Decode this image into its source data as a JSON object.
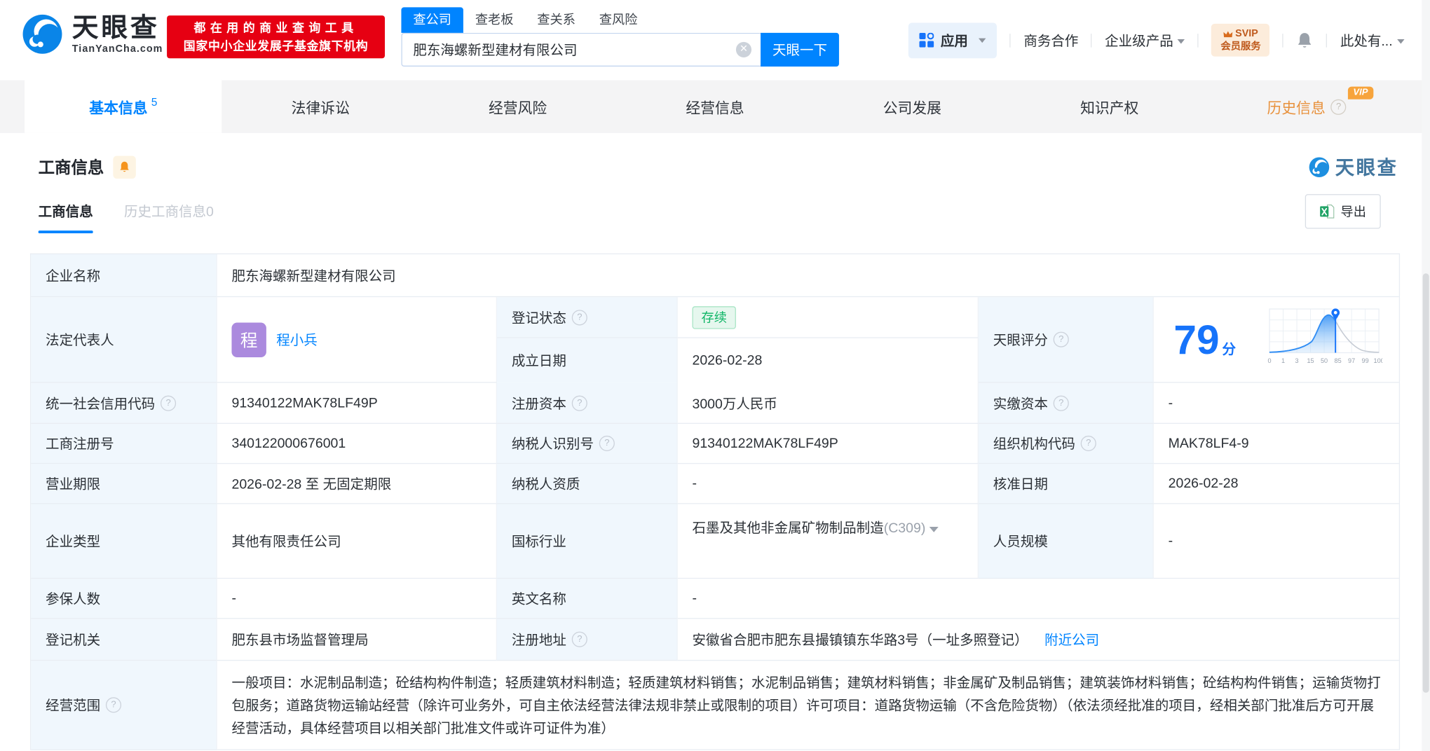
{
  "brand": {
    "name": "天眼查",
    "domain": "TianYanCha.com",
    "slogan_line1": "都在用的商业查询工具",
    "slogan_line2": "国家中小企业发展子基金旗下机构"
  },
  "search": {
    "tabs": [
      "查公司",
      "查老板",
      "查关系",
      "查风险"
    ],
    "value": "肥东海螺新型建材有限公司",
    "button": "天眼一下"
  },
  "topmenu": {
    "apps": "应用",
    "cooperation": "商务合作",
    "enterprise": "企业级产品",
    "svip_line1": "SVIP",
    "svip_line2": "会员服务",
    "more": "此处有..."
  },
  "nav": {
    "tabs": [
      {
        "label": "基本信息",
        "count": "5"
      },
      {
        "label": "法律诉讼"
      },
      {
        "label": "经营风险"
      },
      {
        "label": "经营信息"
      },
      {
        "label": "公司发展"
      },
      {
        "label": "知识产权"
      },
      {
        "label": "历史信息",
        "vip": "VIP"
      }
    ]
  },
  "section": {
    "title": "工商信息",
    "watermark": "天眼查",
    "subtabs": [
      "工商信息",
      "历史工商信息0"
    ],
    "export": "导出"
  },
  "table": {
    "company_name": {
      "label": "企业名称",
      "value": "肥东海螺新型建材有限公司"
    },
    "legal_rep": {
      "label": "法定代表人",
      "avatar": "程",
      "name": "程小兵"
    },
    "reg_status": {
      "label": "登记状态",
      "value": "存续"
    },
    "establish_date": {
      "label": "成立日期",
      "value": "2026-02-28"
    },
    "score": {
      "label": "天眼评分",
      "value": "79",
      "unit": "分"
    },
    "credit_code": {
      "label": "统一社会信用代码",
      "value": "91340122MAK78LF49P"
    },
    "reg_capital": {
      "label": "注册资本",
      "value": "3000万人民币"
    },
    "paid_capital": {
      "label": "实缴资本",
      "value": "-"
    },
    "reg_number": {
      "label": "工商注册号",
      "value": "340122000676001"
    },
    "taxpayer_id": {
      "label": "纳税人识别号",
      "value": "91340122MAK78LF49P"
    },
    "org_code": {
      "label": "组织机构代码",
      "value": "MAK78LF4-9"
    },
    "business_term": {
      "label": "营业期限",
      "value": "2026-02-28 至 无固定期限"
    },
    "taxpayer_quality": {
      "label": "纳税人资质",
      "value": "-"
    },
    "approval_date": {
      "label": "核准日期",
      "value": "2026-02-28"
    },
    "company_type": {
      "label": "企业类型",
      "value": "其他有限责任公司"
    },
    "industry": {
      "label": "国标行业",
      "value": "石墨及其他非金属矿物制品制造",
      "code": "(C309)"
    },
    "staff_size": {
      "label": "人员规模",
      "value": "-"
    },
    "insured_count": {
      "label": "参保人数",
      "value": "-"
    },
    "english_name": {
      "label": "英文名称",
      "value": "-"
    },
    "reg_authority": {
      "label": "登记机关",
      "value": "肥东县市场监督管理局"
    },
    "reg_address": {
      "label": "注册地址",
      "value": "安徽省合肥市肥东县撮镇镇东华路3号（一址多照登记）",
      "nearby": "附近公司"
    },
    "business_scope": {
      "label": "经营范围",
      "value": "一般项目：水泥制品制造；砼结构构件制造；轻质建筑材料制造；轻质建筑材料销售；水泥制品销售；建筑材料销售；非金属矿及制品销售；建筑装饰材料销售；砼结构构件销售；运输货物打包服务；道路货物运输站经营（除许可业务外，可自主依法经营法律法规非禁止或限制的项目）许可项目：道路货物运输（不含危险货物）（依法须经批准的项目，经相关部门批准后方可开展经营活动，具体经营项目以相关部门批准文件或许可证件为准）"
    }
  },
  "chart_data": {
    "type": "area",
    "title": "天眼评分分布曲线",
    "x_ticks": [
      "0",
      "1",
      "3",
      "15",
      "50",
      "85",
      "97",
      "99",
      "100"
    ],
    "marker_value": 79,
    "grid": "on",
    "legend_position": "none"
  },
  "colors": {
    "primary_blue": "#0084ff",
    "brand_red": "#e60012",
    "status_green": "#10b667",
    "vip_orange": "#f7a43c",
    "score_blue": "#1673fa"
  }
}
